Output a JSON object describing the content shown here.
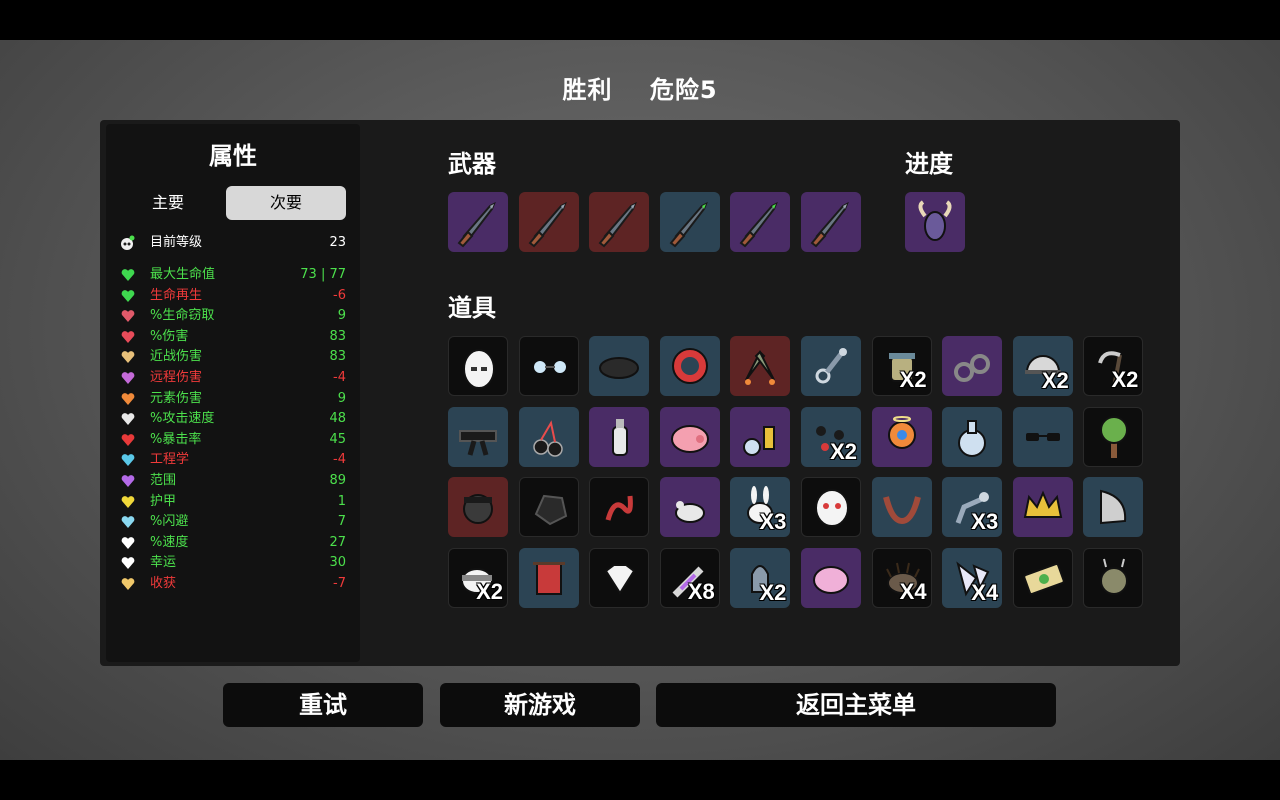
{
  "header": {
    "result": "胜利",
    "danger": "危险5"
  },
  "stats_panel": {
    "title": "属性",
    "tabs": {
      "primary": "主要",
      "secondary": "次要"
    },
    "level": {
      "label": "目前等级",
      "value": "23",
      "icon": "level-icon"
    },
    "rows": [
      {
        "name": "最大生命值",
        "value": "73 | 77",
        "color": "#4ce04c",
        "icon": "heart-icon",
        "icon_color": "#3fd84f"
      },
      {
        "name": "生命再生",
        "value": "-6",
        "color": "#f03a3a",
        "icon": "heart-regen-icon",
        "icon_color": "#3fd84f"
      },
      {
        "name": "%生命窃取",
        "value": "9",
        "color": "#4ce04c",
        "icon": "lifesteal-icon",
        "icon_color": "#e05a6a"
      },
      {
        "name": "%伤害",
        "value": "83",
        "color": "#4ce04c",
        "icon": "fist-icon",
        "icon_color": "#e84c5a"
      },
      {
        "name": "近战伤害",
        "value": "83",
        "color": "#4ce04c",
        "icon": "sword-icon",
        "icon_color": "#e8c07a"
      },
      {
        "name": "远程伤害",
        "value": "-4",
        "color": "#f03a3a",
        "icon": "ranged-icon",
        "icon_color": "#c46ad8"
      },
      {
        "name": "元素伤害",
        "value": "9",
        "color": "#4ce04c",
        "icon": "flame-icon",
        "icon_color": "#f08a3a"
      },
      {
        "name": "%攻击速度",
        "value": "48",
        "color": "#4ce04c",
        "icon": "hourglass-icon",
        "icon_color": "#e8e8e8"
      },
      {
        "name": "%暴击率",
        "value": "45",
        "color": "#4ce04c",
        "icon": "crit-icon",
        "icon_color": "#e83a3a"
      },
      {
        "name": "工程学",
        "value": "-4",
        "color": "#f03a3a",
        "icon": "wrench-icon",
        "icon_color": "#5ac8e8"
      },
      {
        "name": "范围",
        "value": "89",
        "color": "#4ce04c",
        "icon": "range-icon",
        "icon_color": "#b46ae8"
      },
      {
        "name": "护甲",
        "value": "1",
        "color": "#4ce04c",
        "icon": "shield-icon",
        "icon_color": "#f0d83a"
      },
      {
        "name": "%闪避",
        "value": "7",
        "color": "#4ce04c",
        "icon": "dodge-icon",
        "icon_color": "#8ad8f0"
      },
      {
        "name": "%速度",
        "value": "27",
        "color": "#4ce04c",
        "icon": "boot-icon",
        "icon_color": "#ffffff"
      },
      {
        "name": "幸运",
        "value": "30",
        "color": "#4ce04c",
        "icon": "dice-icon",
        "icon_color": "#ffffff"
      },
      {
        "name": "收获",
        "value": "-7",
        "color": "#f03a3a",
        "icon": "harvest-icon",
        "icon_color": "#f0c86a"
      }
    ]
  },
  "weapons": {
    "title": "武器",
    "items": [
      {
        "icon": "knife-icon",
        "tier_color": "#4a2c66"
      },
      {
        "icon": "knife-icon",
        "tier_color": "#5e2424"
      },
      {
        "icon": "knife-icon",
        "tier_color": "#5e2424"
      },
      {
        "icon": "knife-icon",
        "tier_color": "#2c4454"
      },
      {
        "icon": "knife-icon",
        "tier_color": "#4a2c66"
      },
      {
        "icon": "knife-icon",
        "tier_color": "#4a2c66"
      }
    ]
  },
  "progress": {
    "title": "进度",
    "items": [
      {
        "icon": "horned-skull-icon",
        "tier_color": "#4a2c66"
      }
    ]
  },
  "items": {
    "title": "道具",
    "list": [
      {
        "icon": "egg-icon",
        "tier": "black",
        "qty": ""
      },
      {
        "icon": "glasses-icon",
        "tier": "black",
        "qty": ""
      },
      {
        "icon": "beret-icon",
        "tier": "blue",
        "qty": ""
      },
      {
        "icon": "ring-target-icon",
        "tier": "blue",
        "qty": ""
      },
      {
        "icon": "rockets-icon",
        "tier": "red",
        "qty": ""
      },
      {
        "icon": "chain-icon",
        "tier": "blue",
        "qty": ""
      },
      {
        "icon": "jar-icon",
        "tier": "black",
        "qty": "X2"
      },
      {
        "icon": "handcuffs-icon",
        "tier": "purple",
        "qty": ""
      },
      {
        "icon": "helmet-icon",
        "tier": "blue",
        "qty": "X2"
      },
      {
        "icon": "scythe-icon",
        "tier": "black",
        "qty": "X2"
      },
      {
        "icon": "black-belt-icon",
        "tier": "blue",
        "qty": ""
      },
      {
        "icon": "cherry-bomb-icon",
        "tier": "blue",
        "qty": ""
      },
      {
        "icon": "bottle-icon",
        "tier": "purple",
        "qty": ""
      },
      {
        "icon": "piggy-bank-icon",
        "tier": "purple",
        "qty": ""
      },
      {
        "icon": "potion-tools-icon",
        "tier": "purple",
        "qty": ""
      },
      {
        "icon": "blood-drops-icon",
        "tier": "blue",
        "qty": "X2"
      },
      {
        "icon": "jetpack-icon",
        "tier": "purple",
        "qty": ""
      },
      {
        "icon": "flask-icon",
        "tier": "blue",
        "qty": ""
      },
      {
        "icon": "sunglasses-icon",
        "tier": "blue",
        "qty": ""
      },
      {
        "icon": "tree-icon",
        "tier": "black",
        "qty": ""
      },
      {
        "icon": "pirate-icon",
        "tier": "red",
        "qty": ""
      },
      {
        "icon": "coal-icon",
        "tier": "black",
        "qty": ""
      },
      {
        "icon": "snake-icon",
        "tier": "black",
        "qty": ""
      },
      {
        "icon": "mouse-icon",
        "tier": "purple",
        "qty": ""
      },
      {
        "icon": "bunny-icon",
        "tier": "blue",
        "qty": "X3"
      },
      {
        "icon": "ghost-mask-icon",
        "tier": "black",
        "qty": ""
      },
      {
        "icon": "claws-icon",
        "tier": "blue",
        "qty": ""
      },
      {
        "icon": "robot-arm-icon",
        "tier": "blue",
        "qty": "X3"
      },
      {
        "icon": "crown-icon",
        "tier": "purple",
        "qty": ""
      },
      {
        "icon": "blade-shield-icon",
        "tier": "blue",
        "qty": ""
      },
      {
        "icon": "bandana-icon",
        "tier": "black",
        "qty": "X2"
      },
      {
        "icon": "banner-icon",
        "tier": "blue",
        "qty": ""
      },
      {
        "icon": "skull-icon",
        "tier": "black",
        "qty": ""
      },
      {
        "icon": "syringe-icon",
        "tier": "black",
        "qty": "X8"
      },
      {
        "icon": "bullet-icon",
        "tier": "blue",
        "qty": "X2"
      },
      {
        "icon": "brain-icon",
        "tier": "purple",
        "qty": ""
      },
      {
        "icon": "hedgehog-icon",
        "tier": "black",
        "qty": "X4"
      },
      {
        "icon": "shards-icon",
        "tier": "blue",
        "qty": "X4"
      },
      {
        "icon": "banknote-icon",
        "tier": "black",
        "qty": ""
      },
      {
        "icon": "snail-icon",
        "tier": "black",
        "qty": ""
      }
    ]
  },
  "buttons": {
    "retry": "重试",
    "new_game": "新游戏",
    "main_menu": "返回主菜单"
  }
}
